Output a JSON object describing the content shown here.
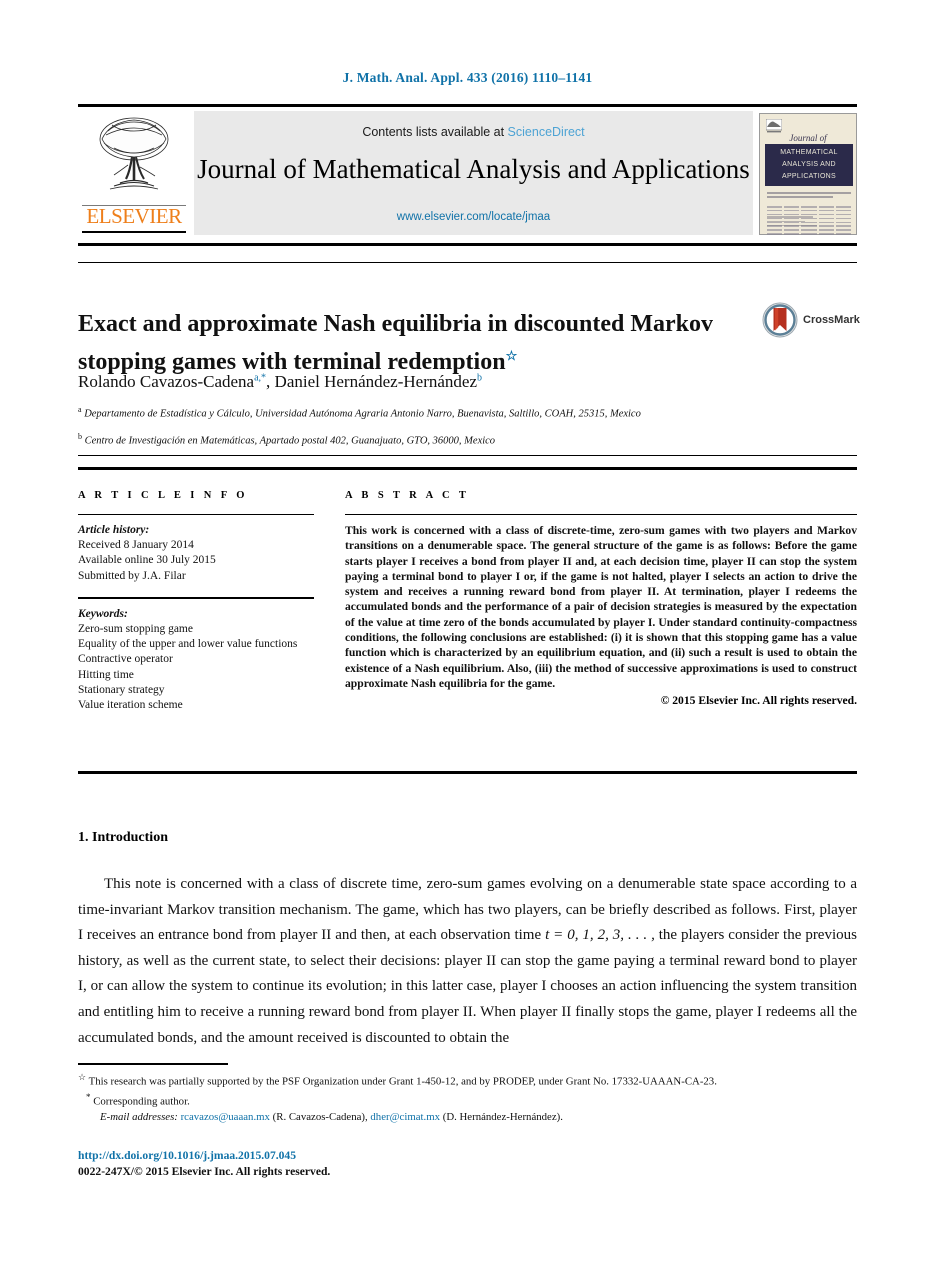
{
  "journal_ref": "J. Math. Anal. Appl. 433 (2016) 1110–1141",
  "masthead": {
    "contents_prefix": "Contents lists available at ",
    "sciencedirect": "ScienceDirect",
    "journal_title": "Journal of Mathematical Analysis and Applications",
    "journal_url": "www.elsevier.com/locate/jmaa",
    "publisher_wordmark": "ELSEVIER",
    "cover": {
      "journal_of": "Journal of",
      "band_title": "MATHEMATICAL ANALYSIS AND APPLICATIONS"
    }
  },
  "article": {
    "title": "Exact and approximate Nash equilibria in discounted Markov stopping games with terminal redemption",
    "title_footnote_mark": "☆",
    "crossmark_label": "CrossMark",
    "authors": [
      {
        "name": "Rolando Cavazos-Cadena",
        "marks": "a,*"
      },
      {
        "name": "Daniel Hernández-Hernández",
        "marks": "b"
      }
    ],
    "affiliations": [
      {
        "mark": "a",
        "text": "Departamento de Estadística y Cálculo, Universidad Autónoma Agraria Antonio Narro, Buenavista, Saltillo, COAH, 25315, Mexico"
      },
      {
        "mark": "b",
        "text": "Centro de Investigación en Matemáticas, Apartado postal 402, Guanajuato, GTO, 36000, Mexico"
      }
    ]
  },
  "info": {
    "heading": "A R T I C L E   I N F O",
    "history_label": "Article history:",
    "history": [
      "Received 8 January 2014",
      "Available online 30 July 2015",
      "Submitted by J.A. Filar"
    ],
    "keywords_label": "Keywords:",
    "keywords": [
      "Zero-sum stopping game",
      "Equality of the upper and lower value functions",
      "Contractive operator",
      "Hitting time",
      "Stationary strategy",
      "Value iteration scheme"
    ]
  },
  "abstract": {
    "heading": "A B S T R A C T",
    "text": "This work is concerned with a class of discrete-time, zero-sum games with two players and Markov transitions on a denumerable space. The general structure of the game is as follows: Before the game starts player I receives a bond from player II and, at each decision time, player II can stop the system paying a terminal bond to player I or, if the game is not halted, player I selects an action to drive the system and receives a running reward bond from player II. At termination, player I redeems the accumulated bonds and the performance of a pair of decision strategies is measured by the expectation of the value at time zero of the bonds accumulated by player I. Under standard continuity-compactness conditions, the following conclusions are established: (i) it is shown that this stopping game has a value function which is characterized by an equilibrium equation, and (ii) such a result is used to obtain the existence of a Nash equilibrium. Also, (iii) the method of successive approximations is used to construct approximate Nash equilibria for the game.",
    "copyright": "© 2015 Elsevier Inc. All rights reserved."
  },
  "section": {
    "heading": "1. Introduction",
    "paragraph_part1": "This note is concerned with a class of discrete time, zero-sum games evolving on a denumerable state space according to a time-invariant Markov transition mechanism. The game, which has two players, can be briefly described as follows. First, player I receives an entrance bond from player II and then, at each observation time ",
    "math_time": "t = 0, 1, 2, 3, . . . ,",
    "paragraph_part2": " the players consider the previous history, as well as the current state, to select their decisions: player II can stop the game paying a terminal reward bond to player I, or can allow the system to continue its evolution; in this latter case, player I chooses an action influencing the system transition and entitling him to receive a running reward bond from player II. When player II finally stops the game, player I redeems all the accumulated bonds, and the amount received is discounted to obtain the"
  },
  "footnotes": {
    "grant_mark": "☆",
    "grant": "This research was partially supported by the PSF Organization under Grant 1-450-12, and by PRODEP, under Grant No. 17332-UAAAN-CA-23.",
    "corresponding_mark": "*",
    "corresponding": "Corresponding author.",
    "email_label": "E-mail addresses:",
    "emails": [
      {
        "address": "rcavazos@uaaan.mx",
        "owner": "(R. Cavazos-Cadena),"
      },
      {
        "address": "dher@cimat.mx",
        "owner": "(D. Hernández-Hernández)."
      }
    ]
  },
  "bottom": {
    "doi": "http://dx.doi.org/10.1016/j.jmaa.2015.07.045",
    "issn_line": "0022-247X/© 2015 Elsevier Inc. All rights reserved."
  },
  "colors": {
    "link_blue": "#1072a8",
    "sciencedirect_blue": "#4da3d4",
    "elsevier_orange": "#ee7f1b",
    "cover_band": "#2b2a4a"
  }
}
